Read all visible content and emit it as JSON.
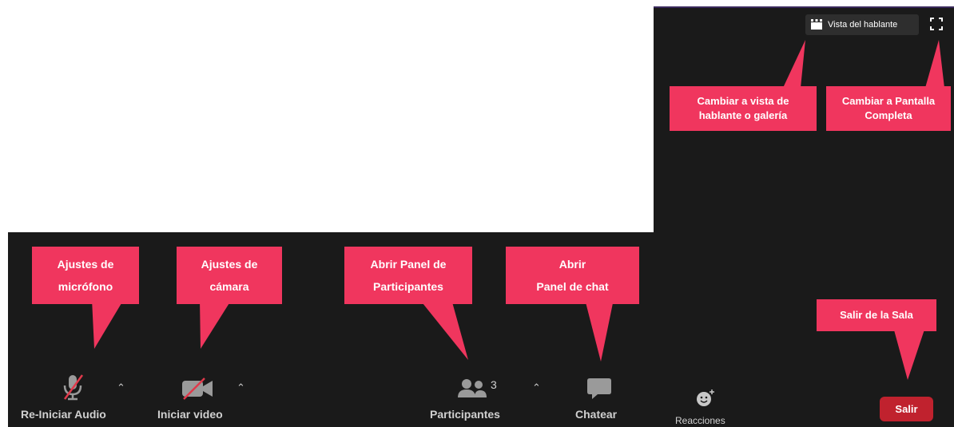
{
  "top_bar": {
    "view_button_label": "Vista del hablante",
    "view_icon": "speaker-view-icon",
    "fullscreen_icon": "fullscreen-icon"
  },
  "callouts": {
    "view": "Cambiar a vista de hablante o galería",
    "view_line1": "Cambiar a vista de",
    "view_line2": "hablante o galería",
    "fullscreen_line1": "Cambiar a Pantalla",
    "fullscreen_line2": "Completa",
    "mic_line1": "Ajustes de",
    "mic_line2": "micrófono",
    "camera_line1": "Ajustes de",
    "camera_line2": "cámara",
    "participants_line1": "Abrir Panel de",
    "participants_line2": "Participantes",
    "chat_line1": "Abrir",
    "chat_line2": "Panel de chat",
    "exit": "Salir de la Sala"
  },
  "toolbar": {
    "audio_label": "Re-Iniciar Audio",
    "video_label": "Iniciar video",
    "participants_label": "Participantes",
    "participants_count": "3",
    "chat_label": "Chatear",
    "reactions_label": "Reacciones",
    "exit_label": "Salir"
  },
  "colors": {
    "callout": "#f0365e",
    "background": "#1a1a1a",
    "exit": "#c0222e"
  }
}
